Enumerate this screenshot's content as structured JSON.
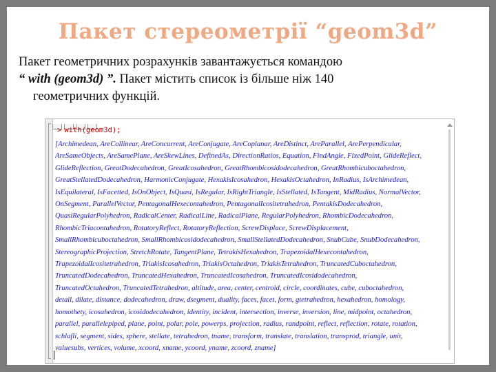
{
  "slide": {
    "title": "Пакет  стереометрії “geom3d”",
    "paragraph": {
      "line1": "Пакет геометричних розрахунків завантажується командою",
      "cmd_quote": "“ with (geom3d) ”.",
      "line2_rest": " Пакет містить список із більше ніж 140",
      "line3": "геометричних функцій."
    }
  },
  "maple": {
    "prompt": ">",
    "command": "with(geom3d);",
    "output_lines": [
      "[Archimedean, AreCollinear, AreConcurrent, AreConjugate, AreCoplanar, AreDistinct, AreParallel, ArePerpendicular,",
      "AreSameObjects, AreSamePlane, AreSkewLines, DefinedAs, DirectionRatios, Equation, FindAngle, FixedPoint, GlideReflect,",
      "GlideReflection, GreatDodecahedron, GreatIcosahedron, GreatRhombicosidodecahedron, GreatRhombicuboctahedron,",
      "GreatStellatedDodecahedron, HarmonicConjugate, HexakisIcosahedron, HexakisOctahedron, InRadius, IsArchimedean,",
      "IsEquilateral, IsFacetted, IsOnObject, IsQuasi, IsRegular, IsRightTriangle, IsStellated, IsTangent, MidRadius, NormalVector,",
      "OnSegment, ParallelVector, PentagonalHexecontahedron, PentagonalIcositetrahedron, PentakisDodecahedron,",
      "QuasiRegularPolyhedron, RadicalCenter, RadicalLine, RadicalPlane, RegularPolyhedron, RhombicDodecahedron,",
      "RhombicTriacontahedron, RotatoryReflect, RotatoryReflection, ScrewDisplace, ScrewDisplacement,",
      "SmallRhombicuboctahedron, SmallRhombicosidodecahedron, SmallStellatedDodecahedron, SnubCube, SnubDodecahedron,",
      "StereographicProjection, StretchRotate, TangentPlane, TetrakisHexahedron, TrapezoidalHexecontahedron,",
      "TrapezoidalIcositetrahedron, TriakisIcosahedron, TriakisOctahedron, TriakisTetrahedron, TruncatedCuboctahedron,",
      "TruncatedDodecahedron, TruncatedHexahedron, TruncatedIcosahedron, TruncatedIcosidodecahedron,",
      "TruncatedOctahedron, TruncatedTetrahedron, altitude, area, center, centroid, circle, coordinates, cube, cuboctahedron,",
      "detail, dilate, distance, dodecahedron, draw, dsegment, duality, faces, facet, form, gtetrahedron, hexahedron, homology,",
      "homothety, icosahedron, icosidodecahedron, identity, incident, intersection, inverse, inversion, line, midpoint, octahedron,",
      "parallel, parallelepiped, plane, point, polar, pole, powerps, projection, radius, randpoint, reflect, reflection, rotate, rotation,",
      "schlafli, segment, sides, sphere, stellate, tetrahedron, tname, transform, translate, translation, transprod, triangle, unit,",
      "valuesubs, vertices, volume, xcoord, xname, ycoord, yname, zcoord, zname]"
    ]
  }
}
